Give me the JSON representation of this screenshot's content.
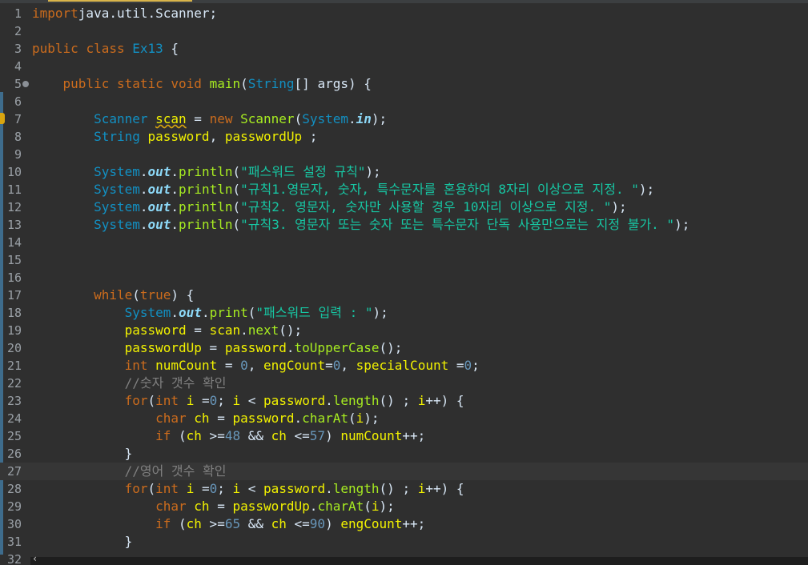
{
  "editor": {
    "lines": [
      {
        "n": "1",
        "tokens": [
          [
            "kw",
            "import"
          ],
          [
            "",
            "java.util.Scanner;"
          ]
        ]
      },
      {
        "n": "2",
        "tokens": []
      },
      {
        "n": "3",
        "tokens": [
          [
            "kw",
            "public"
          ],
          [
            "",
            " "
          ],
          [
            "kw",
            "class"
          ],
          [
            "",
            " "
          ],
          [
            "cls",
            "Ex13"
          ],
          [
            "",
            " {"
          ]
        ]
      },
      {
        "n": "4",
        "tokens": []
      },
      {
        "n": "5",
        "fold": true,
        "tokens": [
          [
            "",
            "    "
          ],
          [
            "kw",
            "public"
          ],
          [
            "",
            " "
          ],
          [
            "kw",
            "static"
          ],
          [
            "",
            " "
          ],
          [
            "kw",
            "void"
          ],
          [
            "",
            " "
          ],
          [
            "fn",
            "main"
          ],
          [
            "",
            "("
          ],
          [
            "cls",
            "String"
          ],
          [
            "",
            "[] "
          ],
          [
            "",
            "args) {"
          ]
        ]
      },
      {
        "n": "6",
        "tokens": []
      },
      {
        "n": "7",
        "warn": true,
        "tokens": [
          [
            "",
            "        "
          ],
          [
            "cls",
            "Scanner"
          ],
          [
            "",
            " "
          ],
          [
            "var sq",
            "scan"
          ],
          [
            "",
            " = "
          ],
          [
            "kw",
            "new"
          ],
          [
            "",
            " "
          ],
          [
            "fn",
            "Scanner"
          ],
          [
            "",
            "("
          ],
          [
            "cls",
            "System"
          ],
          [
            "",
            "."
          ],
          [
            "fld",
            "in"
          ],
          [
            "",
            ");"
          ]
        ]
      },
      {
        "n": "8",
        "tokens": [
          [
            "",
            "        "
          ],
          [
            "cls",
            "String"
          ],
          [
            "",
            " "
          ],
          [
            "var",
            "password"
          ],
          [
            "",
            ", "
          ],
          [
            "var",
            "passwordUp"
          ],
          [
            "",
            " ;"
          ]
        ]
      },
      {
        "n": "9",
        "tokens": []
      },
      {
        "n": "10",
        "tokens": [
          [
            "",
            "        "
          ],
          [
            "cls",
            "System"
          ],
          [
            "",
            "."
          ],
          [
            "fld",
            "out"
          ],
          [
            "",
            "."
          ],
          [
            "fn",
            "println"
          ],
          [
            "",
            "("
          ],
          [
            "str",
            "\"패스워드 설정 규칙\""
          ],
          [
            "",
            ");"
          ]
        ]
      },
      {
        "n": "11",
        "tokens": [
          [
            "",
            "        "
          ],
          [
            "cls",
            "System"
          ],
          [
            "",
            "."
          ],
          [
            "fld",
            "out"
          ],
          [
            "",
            "."
          ],
          [
            "fn",
            "println"
          ],
          [
            "",
            "("
          ],
          [
            "str",
            "\"규칙1.영문자, 숫자, 특수문자를 혼용하여 8자리 이상으로 지정. \""
          ],
          [
            "",
            ");"
          ]
        ]
      },
      {
        "n": "12",
        "tokens": [
          [
            "",
            "        "
          ],
          [
            "cls",
            "System"
          ],
          [
            "",
            "."
          ],
          [
            "fld",
            "out"
          ],
          [
            "",
            "."
          ],
          [
            "fn",
            "println"
          ],
          [
            "",
            "("
          ],
          [
            "str",
            "\"규칙2. 영문자, 숫자만 사용할 경우 10자리 이상으로 지정. \""
          ],
          [
            "",
            ");"
          ]
        ]
      },
      {
        "n": "13",
        "tokens": [
          [
            "",
            "        "
          ],
          [
            "cls",
            "System"
          ],
          [
            "",
            "."
          ],
          [
            "fld",
            "out"
          ],
          [
            "",
            "."
          ],
          [
            "fn",
            "println"
          ],
          [
            "",
            "("
          ],
          [
            "str",
            "\"규칙3. 영문자 또는 숫자 또는 특수문자 단독 사용만으로는 지정 불가. \""
          ],
          [
            "",
            ");"
          ]
        ]
      },
      {
        "n": "14",
        "tokens": []
      },
      {
        "n": "15",
        "tokens": []
      },
      {
        "n": "16",
        "tokens": []
      },
      {
        "n": "17",
        "tokens": [
          [
            "",
            "        "
          ],
          [
            "kw",
            "while"
          ],
          [
            "",
            "("
          ],
          [
            "kw",
            "true"
          ],
          [
            "",
            ") {"
          ]
        ]
      },
      {
        "n": "18",
        "tokens": [
          [
            "",
            "            "
          ],
          [
            "cls",
            "System"
          ],
          [
            "",
            "."
          ],
          [
            "fld",
            "out"
          ],
          [
            "",
            "."
          ],
          [
            "fn",
            "print"
          ],
          [
            "",
            "("
          ],
          [
            "str",
            "\"패스워드 입력 : \""
          ],
          [
            "",
            ");"
          ]
        ]
      },
      {
        "n": "19",
        "tokens": [
          [
            "",
            "            "
          ],
          [
            "var",
            "password"
          ],
          [
            "",
            " = "
          ],
          [
            "var",
            "scan"
          ],
          [
            "",
            "."
          ],
          [
            "fn",
            "next"
          ],
          [
            "",
            "();"
          ]
        ]
      },
      {
        "n": "20",
        "tokens": [
          [
            "",
            "            "
          ],
          [
            "var",
            "passwordUp"
          ],
          [
            "",
            " = "
          ],
          [
            "var",
            "password"
          ],
          [
            "",
            "."
          ],
          [
            "fn",
            "toUpperCase"
          ],
          [
            "",
            "();"
          ]
        ]
      },
      {
        "n": "21",
        "tokens": [
          [
            "",
            "            "
          ],
          [
            "kw",
            "int"
          ],
          [
            "",
            " "
          ],
          [
            "var",
            "numCount"
          ],
          [
            "",
            " = "
          ],
          [
            "num",
            "0"
          ],
          [
            "",
            ", "
          ],
          [
            "var",
            "engCount"
          ],
          [
            "",
            "="
          ],
          [
            "num",
            "0"
          ],
          [
            "",
            ", "
          ],
          [
            "var",
            "specialCount"
          ],
          [
            "",
            " ="
          ],
          [
            "num",
            "0"
          ],
          [
            "",
            ";"
          ]
        ]
      },
      {
        "n": "22",
        "tokens": [
          [
            "",
            "            "
          ],
          [
            "cmt",
            "//숫자 갯수 확인"
          ]
        ]
      },
      {
        "n": "23",
        "tokens": [
          [
            "",
            "            "
          ],
          [
            "kw",
            "for"
          ],
          [
            "",
            "("
          ],
          [
            "kw",
            "int"
          ],
          [
            "",
            " "
          ],
          [
            "var",
            "i"
          ],
          [
            "",
            " ="
          ],
          [
            "num",
            "0"
          ],
          [
            "",
            "; "
          ],
          [
            "var",
            "i"
          ],
          [
            "",
            " < "
          ],
          [
            "var",
            "password"
          ],
          [
            "",
            "."
          ],
          [
            "fn",
            "length"
          ],
          [
            "",
            "() ; "
          ],
          [
            "var",
            "i"
          ],
          [
            "",
            "++) {"
          ]
        ]
      },
      {
        "n": "24",
        "tokens": [
          [
            "",
            "                "
          ],
          [
            "kw",
            "char"
          ],
          [
            "",
            " "
          ],
          [
            "var",
            "ch"
          ],
          [
            "",
            " = "
          ],
          [
            "var",
            "password"
          ],
          [
            "",
            "."
          ],
          [
            "fn",
            "charAt"
          ],
          [
            "",
            "("
          ],
          [
            "var",
            "i"
          ],
          [
            "",
            ");"
          ]
        ]
      },
      {
        "n": "25",
        "tokens": [
          [
            "",
            "                "
          ],
          [
            "kw",
            "if"
          ],
          [
            "",
            " ("
          ],
          [
            "var",
            "ch"
          ],
          [
            "",
            " >="
          ],
          [
            "num",
            "48"
          ],
          [
            "",
            " && "
          ],
          [
            "var",
            "ch"
          ],
          [
            "",
            " <="
          ],
          [
            "num",
            "57"
          ],
          [
            "",
            ") "
          ],
          [
            "var",
            "numCount"
          ],
          [
            "",
            "++;"
          ]
        ]
      },
      {
        "n": "26",
        "tokens": [
          [
            "",
            "            }"
          ]
        ]
      },
      {
        "n": "27",
        "current": true,
        "tokens": [
          [
            "",
            "            "
          ],
          [
            "cmt",
            "//영어 갯수 확인"
          ]
        ]
      },
      {
        "n": "28",
        "tokens": [
          [
            "",
            "            "
          ],
          [
            "kw",
            "for"
          ],
          [
            "",
            "("
          ],
          [
            "kw",
            "int"
          ],
          [
            "",
            " "
          ],
          [
            "var",
            "i"
          ],
          [
            "",
            " ="
          ],
          [
            "num",
            "0"
          ],
          [
            "",
            "; "
          ],
          [
            "var",
            "i"
          ],
          [
            "",
            " < "
          ],
          [
            "var",
            "password"
          ],
          [
            "",
            "."
          ],
          [
            "fn",
            "length"
          ],
          [
            "",
            "() ; "
          ],
          [
            "var",
            "i"
          ],
          [
            "",
            "++) {"
          ]
        ]
      },
      {
        "n": "29",
        "tokens": [
          [
            "",
            "                "
          ],
          [
            "kw",
            "char"
          ],
          [
            "",
            " "
          ],
          [
            "var",
            "ch"
          ],
          [
            "",
            " = "
          ],
          [
            "var",
            "passwordUp"
          ],
          [
            "",
            "."
          ],
          [
            "fn",
            "charAt"
          ],
          [
            "",
            "("
          ],
          [
            "var",
            "i"
          ],
          [
            "",
            ");"
          ]
        ]
      },
      {
        "n": "30",
        "tokens": [
          [
            "",
            "                "
          ],
          [
            "kw",
            "if"
          ],
          [
            "",
            " ("
          ],
          [
            "var",
            "ch"
          ],
          [
            "",
            " >="
          ],
          [
            "num",
            "65"
          ],
          [
            "",
            " && "
          ],
          [
            "var",
            "ch"
          ],
          [
            "",
            " <="
          ],
          [
            "num",
            "90"
          ],
          [
            "",
            ") "
          ],
          [
            "var",
            "engCount"
          ],
          [
            "",
            "++;"
          ]
        ]
      },
      {
        "n": "31",
        "tokens": [
          [
            "",
            "            }"
          ]
        ]
      },
      {
        "n": "32",
        "tokens": []
      }
    ],
    "scroll_left_glyph": "‹"
  }
}
